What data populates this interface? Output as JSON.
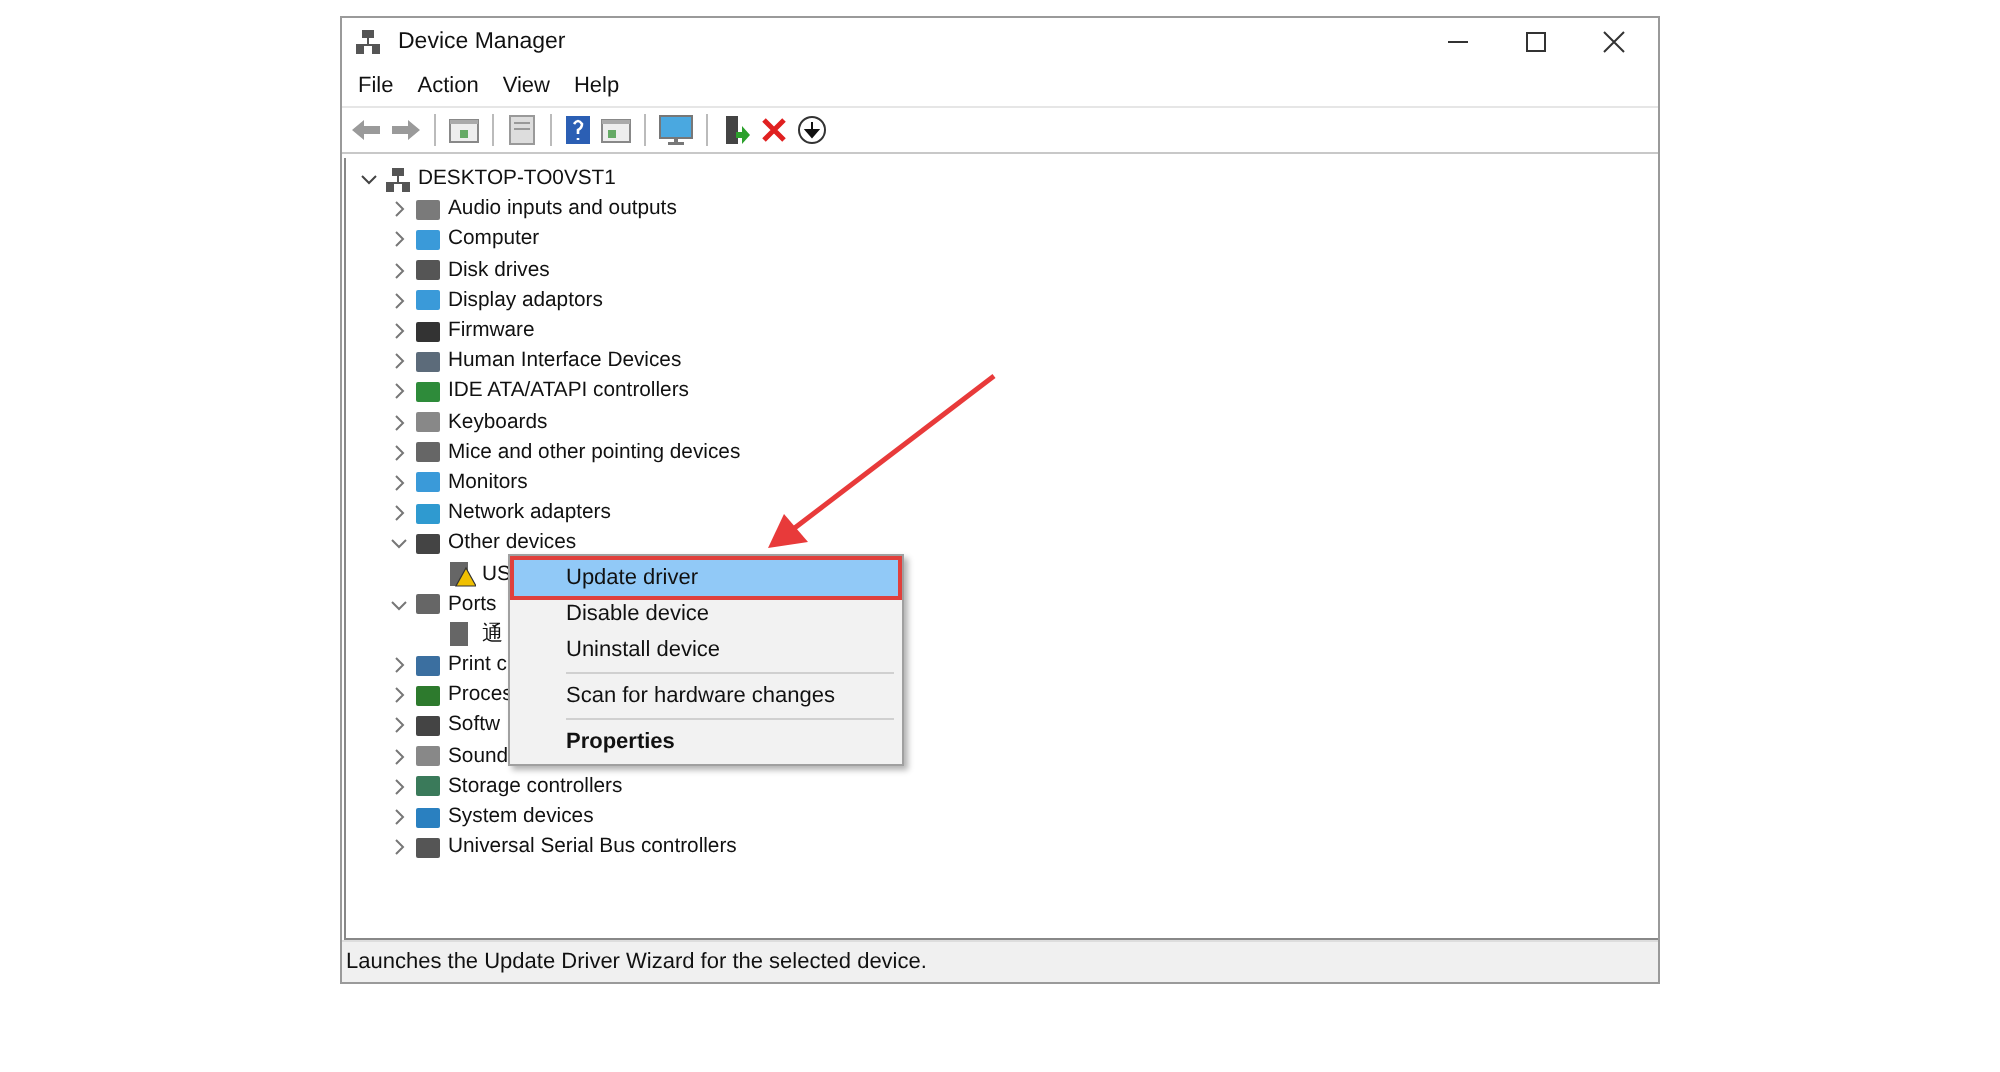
{
  "window": {
    "title": "Device Manager"
  },
  "menu_bar": [
    "File",
    "Action",
    "View",
    "Help"
  ],
  "tree": {
    "label": "DESKTOP-TO0VST1",
    "expanded": true,
    "children": [
      {
        "label": "Audio inputs and outputs",
        "expanded": false
      },
      {
        "label": "Computer",
        "expanded": false
      },
      {
        "label": "Disk drives",
        "expanded": false
      },
      {
        "label": "Display adaptors",
        "expanded": false
      },
      {
        "label": "Firmware",
        "expanded": false
      },
      {
        "label": "Human Interface Devices",
        "expanded": false
      },
      {
        "label": "IDE ATA/ATAPI controllers",
        "expanded": false
      },
      {
        "label": "Keyboards",
        "expanded": false
      },
      {
        "label": "Mice and other pointing devices",
        "expanded": false
      },
      {
        "label": "Monitors",
        "expanded": false
      },
      {
        "label": "Network adapters",
        "expanded": false
      },
      {
        "label": "Other devices",
        "expanded": true,
        "children": [
          {
            "label": "US",
            "warning": true
          }
        ]
      },
      {
        "label": "Ports",
        "expanded": true,
        "children": [
          {
            "label": "通",
            "warning": false
          }
        ]
      },
      {
        "label": "Print c",
        "expanded": false
      },
      {
        "label": "Proces",
        "expanded": false
      },
      {
        "label": "Softw",
        "expanded": false
      },
      {
        "label": "Sound",
        "expanded": false
      },
      {
        "label": "Storage controllers",
        "expanded": false
      },
      {
        "label": "System devices",
        "expanded": false
      },
      {
        "label": "Universal Serial Bus controllers",
        "expanded": false
      }
    ]
  },
  "context_menu": [
    [
      {
        "label": "Update driver",
        "selected": true,
        "default": false
      },
      {
        "label": "Disable device",
        "selected": false,
        "default": false
      },
      {
        "label": "Uninstall device",
        "selected": false,
        "default": false
      }
    ],
    [
      {
        "label": "Scan for hardware changes",
        "selected": false,
        "default": false
      }
    ],
    [
      {
        "label": "Properties",
        "selected": false,
        "default": true
      }
    ]
  ],
  "status_bar": "Launches the Update Driver Wizard for the selected device."
}
